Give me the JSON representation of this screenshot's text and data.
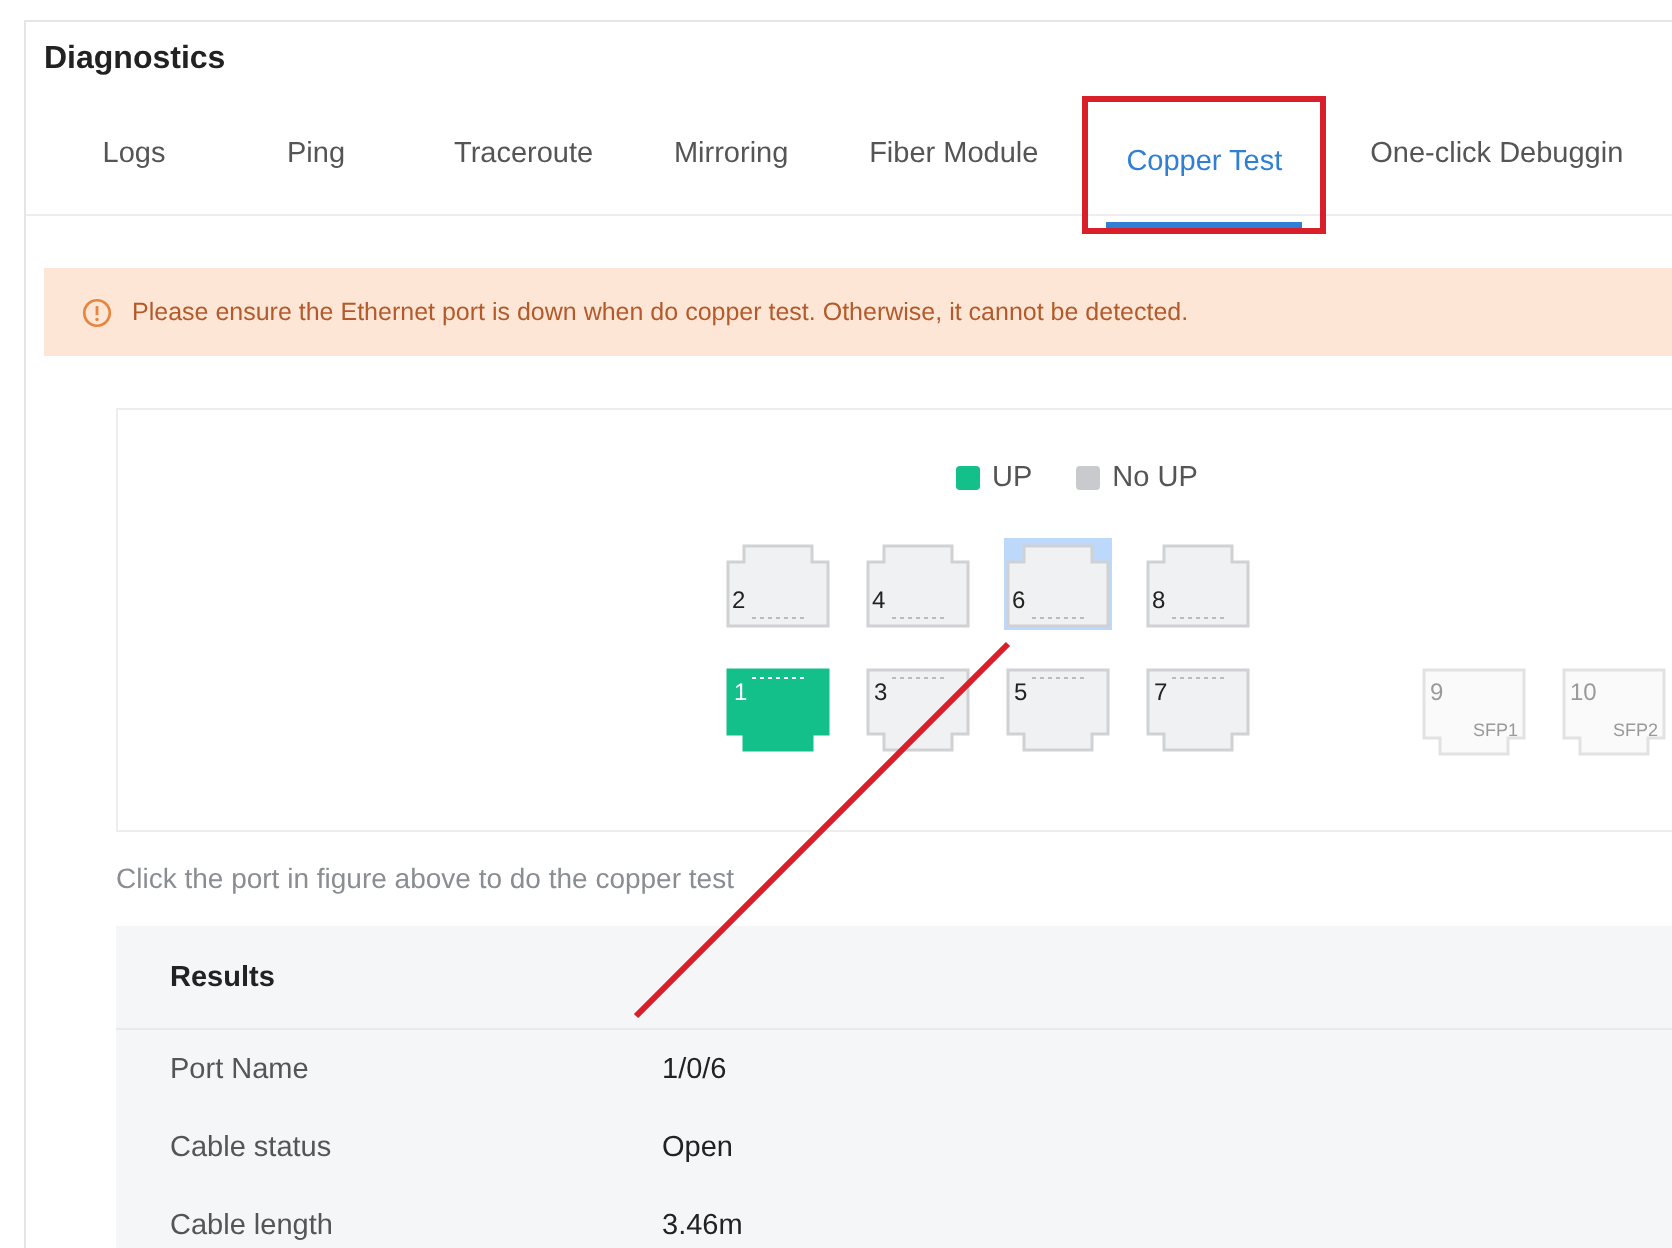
{
  "title": "Diagnostics",
  "tabs": [
    {
      "label": "Logs",
      "selected": false
    },
    {
      "label": "Ping",
      "selected": false
    },
    {
      "label": "Traceroute",
      "selected": false
    },
    {
      "label": "Mirroring",
      "selected": false
    },
    {
      "label": "Fiber Module",
      "selected": false
    },
    {
      "label": "Copper Test",
      "selected": true,
      "highlighted": true
    },
    {
      "label": "One-click Debuggin",
      "selected": false
    }
  ],
  "alert": {
    "text": "Please ensure the Ethernet port is down when do copper test. Otherwise, it cannot be detected."
  },
  "legend": [
    {
      "label": "UP",
      "color": "#14c08a"
    },
    {
      "label": "No UP",
      "color": "#c8cacd"
    }
  ],
  "top_row": [
    {
      "number": "2",
      "kind": "rj45",
      "up": false,
      "selected": false
    },
    {
      "number": "4",
      "kind": "rj45",
      "up": false,
      "selected": false
    },
    {
      "number": "6",
      "kind": "rj45",
      "up": false,
      "selected": true
    },
    {
      "number": "8",
      "kind": "rj45",
      "up": false,
      "selected": false
    }
  ],
  "bottom_row": [
    {
      "number": "1",
      "kind": "rj45",
      "up": true,
      "selected": false
    },
    {
      "number": "3",
      "kind": "rj45",
      "up": false,
      "selected": false
    },
    {
      "number": "5",
      "kind": "rj45",
      "up": false,
      "selected": false
    },
    {
      "number": "7",
      "kind": "rj45",
      "up": false,
      "selected": false
    },
    {
      "number": "9",
      "kind": "sfp",
      "sublabel": "SFP1",
      "up": false,
      "selected": false
    },
    {
      "number": "10",
      "kind": "sfp",
      "sublabel": "SFP2",
      "up": false,
      "selected": false
    }
  ],
  "hint": "Click the port in figure above to do the copper test",
  "results": {
    "title": "Results",
    "rows": [
      {
        "label": "Port Name",
        "value": "1/0/6"
      },
      {
        "label": "Cable status",
        "value": "Open"
      },
      {
        "label": "Cable length",
        "value": "3.46m"
      }
    ]
  },
  "annotation": {
    "arrow": true
  }
}
